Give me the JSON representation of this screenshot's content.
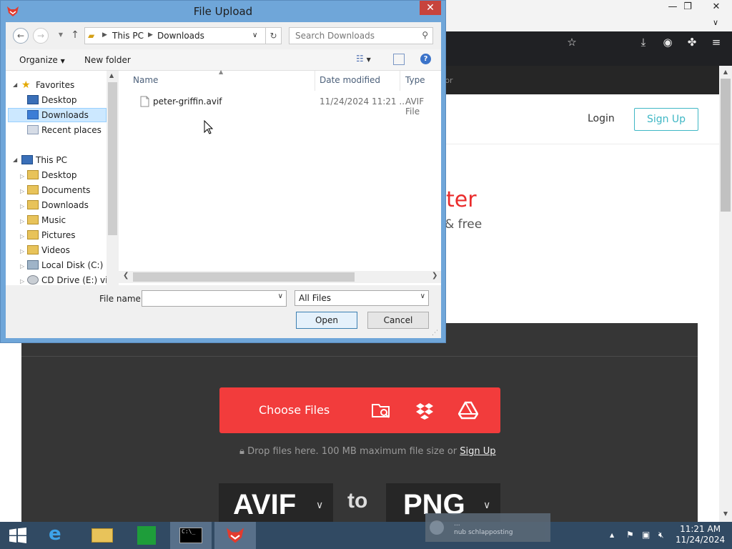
{
  "browser": {
    "window_controls": {
      "minimize": "—",
      "restore": "❐",
      "close": "✕"
    },
    "tab_chevron": "∨",
    "nav_tail": "tor",
    "header": {
      "login": "Login",
      "signup": "Sign Up"
    },
    "hero": {
      "title_fragment": "ter",
      "subtitle_fragment": "& free"
    },
    "uploader": {
      "choose_files": "Choose Files",
      "drop_text": "Drop files here. 100 MB maximum file size or",
      "drop_link": "Sign Up",
      "from_format": "AVIF",
      "to_word": "to",
      "to_format": "PNG"
    }
  },
  "dialog": {
    "title": "File Upload",
    "close_glyph": "✕",
    "address": {
      "root": "This PC",
      "current": "Downloads"
    },
    "search_placeholder": "Search Downloads",
    "commands": {
      "organize": "Organize",
      "new_folder": "New folder",
      "help": "?"
    },
    "favorites": {
      "label": "Favorites",
      "items": [
        "Desktop",
        "Downloads",
        "Recent places"
      ],
      "selected": "Downloads"
    },
    "this_pc": {
      "label": "This PC",
      "items": [
        "Desktop",
        "Documents",
        "Downloads",
        "Music",
        "Pictures",
        "Videos",
        "Local Disk (C:)",
        "CD Drive (E:) virti"
      ]
    },
    "columns": {
      "name": "Name",
      "date_modified": "Date modified",
      "type": "Type"
    },
    "files": [
      {
        "name": "peter-griffin.avif",
        "date": "11/24/2024 11:21 ...",
        "type": "AVIF File"
      }
    ],
    "file_name_label": "File name:",
    "file_name_value": "",
    "filter_value": "All Files",
    "open_label": "Open",
    "cancel_label": "Cancel"
  },
  "taskbar": {
    "time": "11:21 AM",
    "date": "11/24/2024",
    "notification": {
      "line1": "...",
      "line2": "nub schlapposting"
    }
  },
  "colors": {
    "accent_red": "#f23c3c",
    "teal": "#3fb7c5",
    "dialog_frame": "#6fa6d9",
    "taskbar": "#314a63"
  }
}
